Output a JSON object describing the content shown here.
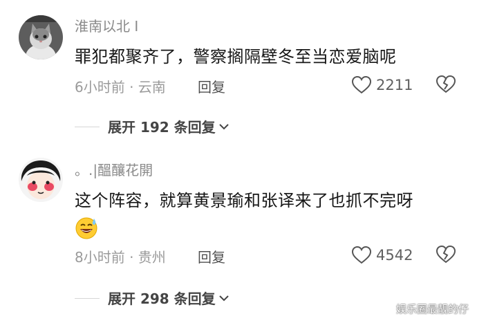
{
  "comments": [
    {
      "username": "淮南以北 I",
      "content": "罪犯都聚齐了，警察搁隔壁冬至当恋爱脑呢",
      "time_location": "6小时前 · 云南",
      "reply_label": "回复",
      "likes": "2211",
      "expand_label": "展开 192 条回复",
      "avatar_icon": "cat-avatar"
    },
    {
      "username": "。.|醞釀花開",
      "content": "这个阵容，就算黄景瑜和张译来了也抓不完呀",
      "emoji": "sweat-smile-emoji",
      "time_location": "8小时前 · 贵州",
      "reply_label": "回复",
      "likes": "4542",
      "expand_label": "展开 298 条回复",
      "avatar_icon": "cartoon-face-avatar"
    }
  ],
  "watermark": "娱乐圈最靓的仔",
  "colors": {
    "username": "#8a8a8a",
    "content": "#161616",
    "meta": "#9a9a9a"
  }
}
